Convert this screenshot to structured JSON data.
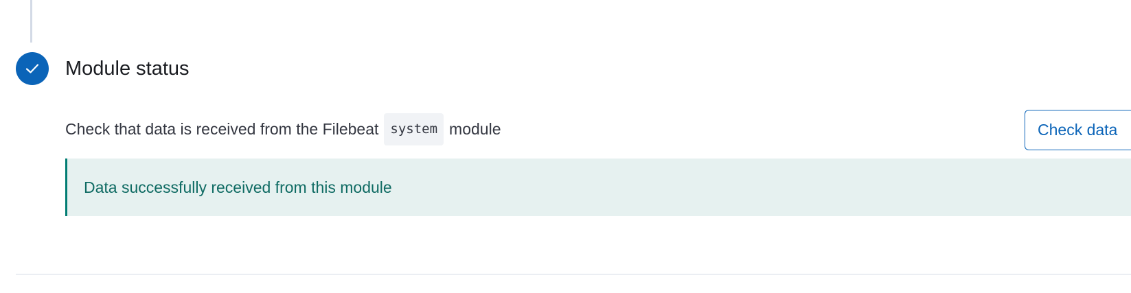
{
  "step": {
    "title": "Module status",
    "status": "complete",
    "icon": "check-icon"
  },
  "description": {
    "prefix": "Check that data is received from the Filebeat",
    "module_code": "system",
    "suffix": "module"
  },
  "check_button": {
    "label": "Check data"
  },
  "callout": {
    "message": "Data successfully received from this module",
    "type": "success"
  },
  "colors": {
    "primary": "#0b64b8",
    "success_text": "#0f6b63",
    "success_bg": "#e6f1f0",
    "success_border": "#017d73"
  }
}
